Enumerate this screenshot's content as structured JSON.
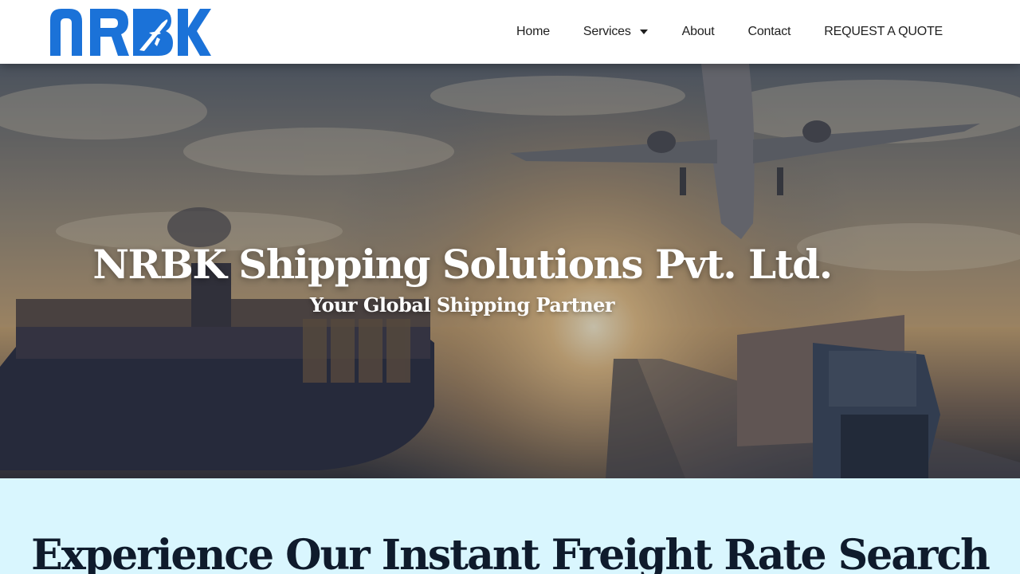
{
  "brand": {
    "logo_text": "NRBK",
    "logo_color": "#1b72d8"
  },
  "nav": {
    "items": [
      {
        "label": "Home"
      },
      {
        "label": "Services",
        "has_dropdown": true
      },
      {
        "label": "About"
      },
      {
        "label": "Contact"
      },
      {
        "label": "REQUEST A QUOTE"
      }
    ]
  },
  "hero": {
    "title": "NRBK Shipping Solutions Pvt. Ltd.",
    "subtitle": "Your Global Shipping Partner"
  },
  "section": {
    "title": "Experience Our Instant Freight Rate Search",
    "background": "#d9f6fe"
  }
}
